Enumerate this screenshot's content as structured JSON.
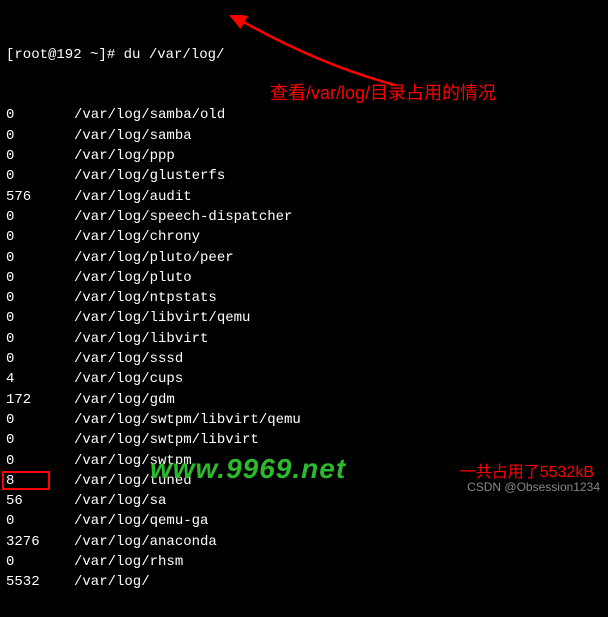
{
  "prompt": "[root@192 ~]# ",
  "command": "du /var/log/",
  "rows": [
    {
      "size": "0",
      "path": "/var/log/samba/old"
    },
    {
      "size": "0",
      "path": "/var/log/samba"
    },
    {
      "size": "0",
      "path": "/var/log/ppp"
    },
    {
      "size": "0",
      "path": "/var/log/glusterfs"
    },
    {
      "size": "576",
      "path": "/var/log/audit"
    },
    {
      "size": "0",
      "path": "/var/log/speech-dispatcher"
    },
    {
      "size": "0",
      "path": "/var/log/chrony"
    },
    {
      "size": "0",
      "path": "/var/log/pluto/peer"
    },
    {
      "size": "0",
      "path": "/var/log/pluto"
    },
    {
      "size": "0",
      "path": "/var/log/ntpstats"
    },
    {
      "size": "0",
      "path": "/var/log/libvirt/qemu"
    },
    {
      "size": "0",
      "path": "/var/log/libvirt"
    },
    {
      "size": "0",
      "path": "/var/log/sssd"
    },
    {
      "size": "4",
      "path": "/var/log/cups"
    },
    {
      "size": "172",
      "path": "/var/log/gdm"
    },
    {
      "size": "0",
      "path": "/var/log/swtpm/libvirt/qemu"
    },
    {
      "size": "0",
      "path": "/var/log/swtpm/libvirt"
    },
    {
      "size": "0",
      "path": "/var/log/swtpm"
    },
    {
      "size": "8",
      "path": "/var/log/tuned"
    },
    {
      "size": "56",
      "path": "/var/log/sa"
    },
    {
      "size": "0",
      "path": "/var/log/qemu-ga"
    },
    {
      "size": "3276",
      "path": "/var/log/anaconda"
    },
    {
      "size": "0",
      "path": "/var/log/rhsm"
    },
    {
      "size": "5532",
      "path": "/var/log/"
    }
  ],
  "annotation1": "查看/var/log/目录占用的情况",
  "annotation2": "一共占用了5532kB",
  "watermark1": "www.9969.net",
  "watermark2": "CSDN @Obsession1234",
  "colors": {
    "bg": "#000000",
    "fg": "#ffffff",
    "annotation": "#ff0000",
    "watermark_green": "#2db92d"
  }
}
